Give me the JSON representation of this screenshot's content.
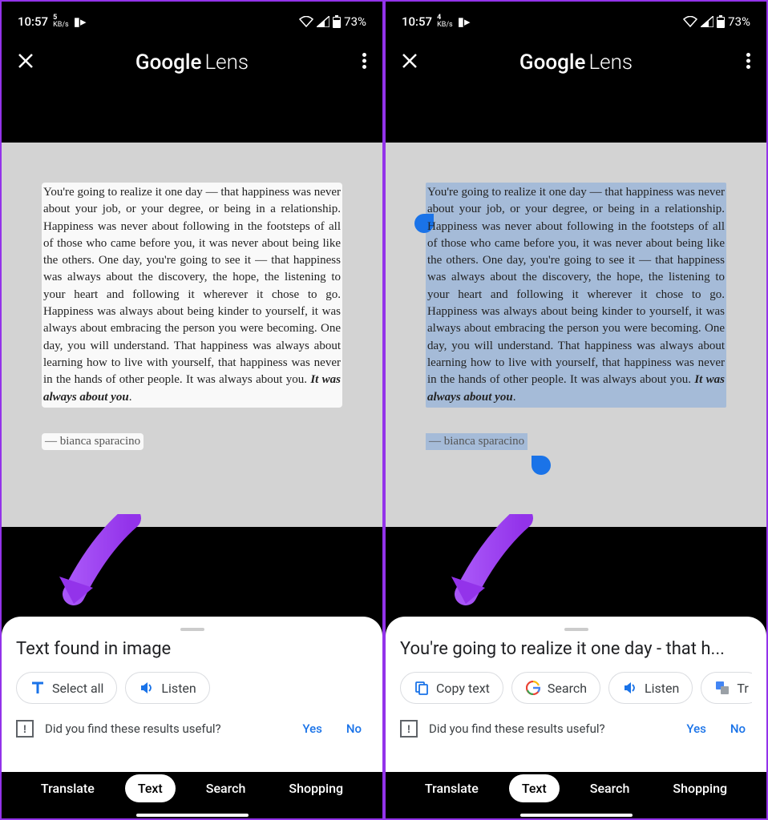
{
  "status": {
    "time": "10:57",
    "speed_val": "5",
    "speed_unit": "KB/s",
    "speed_val2": "4",
    "battery": "73%"
  },
  "header": {
    "title_g": "Google",
    "title_l": "Lens"
  },
  "quote": {
    "text": "You're going to realize it one day — that happiness was never about your job, or your degree, or being in a relationship. Happiness was never about following in the footsteps of all of those who came before you, it was never about being like the others. One day, you're going to see it — that happiness was always about the discovery, the hope, the listening to your heart and following it wherever it chose to go. Happiness was always about being kinder to yourself, it was always about embracing the person you were becoming. One day, you will understand. That happiness was always about learning how to live with yourself, that happiness was never in the hands of other people. It was always about you. ",
    "emphasis": "It was always about you",
    "period": ".",
    "author": "— bianca sparacino"
  },
  "sheet_left": {
    "title": "Text found in image",
    "select_all": "Select all",
    "listen": "Listen"
  },
  "sheet_right": {
    "title": "You're going to realize it one day - that h...",
    "copy": "Copy text",
    "search": "Search",
    "listen": "Listen",
    "translate": "Tr"
  },
  "feedback": {
    "text": "Did you find these results useful?",
    "yes": "Yes",
    "no": "No"
  },
  "modes": {
    "translate": "Translate",
    "text": "Text",
    "search": "Search",
    "shopping": "Shopping"
  }
}
